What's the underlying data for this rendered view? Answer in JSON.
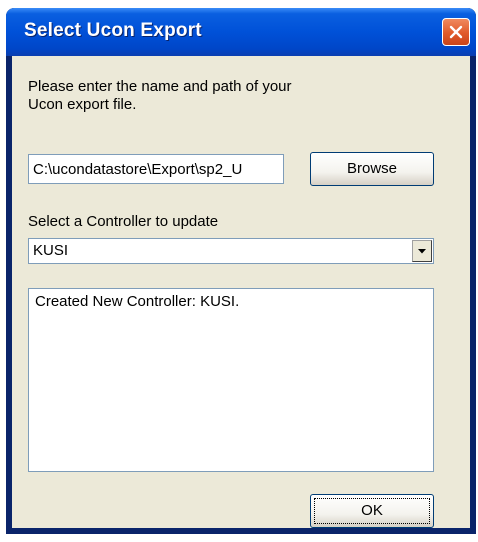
{
  "window": {
    "title": "Select Ucon Export"
  },
  "prompt": {
    "line1": "Please enter the name and path of your",
    "line2": "Ucon export file."
  },
  "path_input": {
    "value": "C:\\ucondatastore\\Export\\sp2_U"
  },
  "browse_button": {
    "label": "Browse"
  },
  "controller": {
    "label": "Select a Controller to update",
    "selected": "KUSI"
  },
  "log": {
    "text": "Created New Controller: KUSI."
  },
  "ok_button": {
    "label": "OK"
  },
  "icons": {
    "close": "close-icon",
    "dropdown": "chevron-down-icon"
  },
  "colors": {
    "titlebar": "#0051d8",
    "client": "#ece9d8",
    "close_button": "#e05a2a"
  }
}
